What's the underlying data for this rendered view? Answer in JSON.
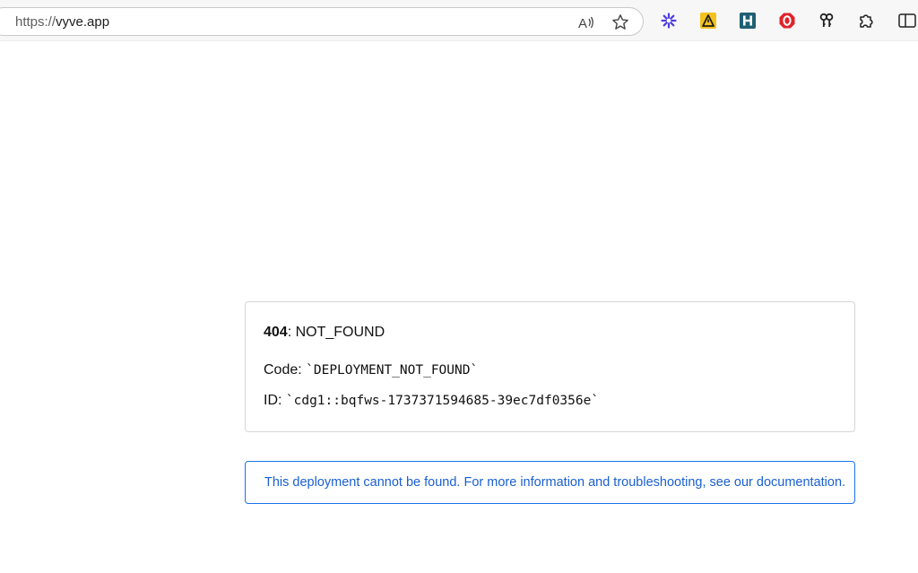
{
  "browser": {
    "url_scheme": "https://",
    "url_host": "vyve.app",
    "icons": {
      "read_aloud": "read-aloud-icon",
      "favorite": "star-icon"
    },
    "extensions": [
      {
        "name": "asterisk-extension-icon",
        "color": "#4b3ee0"
      },
      {
        "name": "warning-extension-icon",
        "color": "#f4c21d"
      },
      {
        "name": "h-extension-icon",
        "color": "#1f5f73"
      },
      {
        "name": "stop-extension-icon",
        "color": "#e0232a"
      },
      {
        "name": "keys-extension-icon",
        "color": "#222222"
      },
      {
        "name": "puzzle-extensions-icon",
        "color": "#222222"
      },
      {
        "name": "split-screen-icon",
        "color": "#222222"
      }
    ]
  },
  "error": {
    "status_code": "404",
    "status_text": ": NOT_FOUND",
    "code_label": "Code: ",
    "code_value": "`DEPLOYMENT_NOT_FOUND`",
    "id_label": "ID: ",
    "id_value": "`cdg1::bqfws-1737371594685-39ec7df0356e`"
  },
  "info": {
    "message": "This deployment cannot be found. For more information and troubleshooting, see our documentation."
  },
  "colors": {
    "accent_blue": "#1a73e8",
    "info_text": "#1a5fd0",
    "card_border": "#d6d6d6"
  }
}
